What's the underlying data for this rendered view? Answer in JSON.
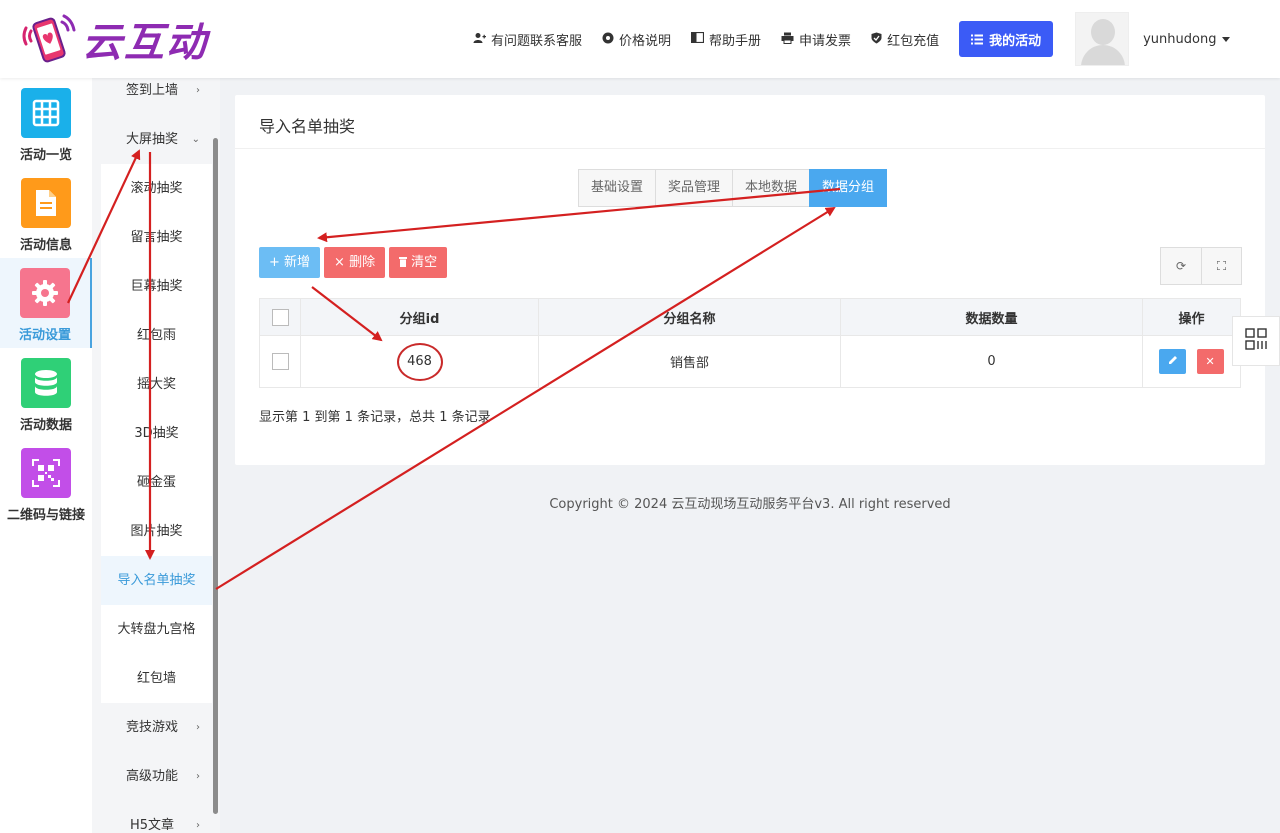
{
  "brand": {
    "name": "云互动"
  },
  "topnav": {
    "support": "有问题联系客服",
    "pricing": "价格说明",
    "help": "帮助手册",
    "invoice": "申请发票",
    "recharge": "红包充值",
    "my_activity": "我的活动",
    "username": "yunhudong"
  },
  "iconbar": [
    {
      "label": "活动一览",
      "icon": "grid-icon",
      "color": "#1ab0ea"
    },
    {
      "label": "活动信息",
      "icon": "document-icon",
      "color": "#ff9a1a"
    },
    {
      "label": "活动设置",
      "icon": "gear-icon",
      "color": "#f6758e"
    },
    {
      "label": "活动数据",
      "icon": "database-icon",
      "color": "#2fd077"
    },
    {
      "label": "二维码与链接",
      "icon": "qrcode-icon",
      "color": "#c24ee8"
    }
  ],
  "submenu": {
    "items": [
      "签到上墙",
      "大屏抽奖",
      "滚动抽奖",
      "留言抽奖",
      "巨幕抽奖",
      "红包雨",
      "摇大奖",
      "3D抽奖",
      "砸金蛋",
      "图片抽奖",
      "导入名单抽奖",
      "大转盘九宫格",
      "红包墙",
      "竞技游戏",
      "高级功能",
      "H5文章"
    ]
  },
  "panel": {
    "title": "导入名单抽奖",
    "tabs": [
      "基础设置",
      "奖品管理",
      "本地数据",
      "数据分组"
    ],
    "buttons": {
      "add": "新增",
      "delete": "删除",
      "clear": "清空"
    },
    "table": {
      "columns": [
        "分组id",
        "分组名称",
        "数据数量",
        "操作"
      ],
      "rows": [
        {
          "id": "468",
          "name": "销售部",
          "count": "0"
        }
      ]
    },
    "records": "显示第 1 到第 1 条记录，总共 1 条记录"
  },
  "footer": "Copyright © 2024 云互动现场互动服务平台v3. All right reserved",
  "colors": {
    "primary": "#3b5bf6",
    "accent": "#4aa8ef",
    "danger": "#f36b6b",
    "annotation": "#d42020"
  }
}
